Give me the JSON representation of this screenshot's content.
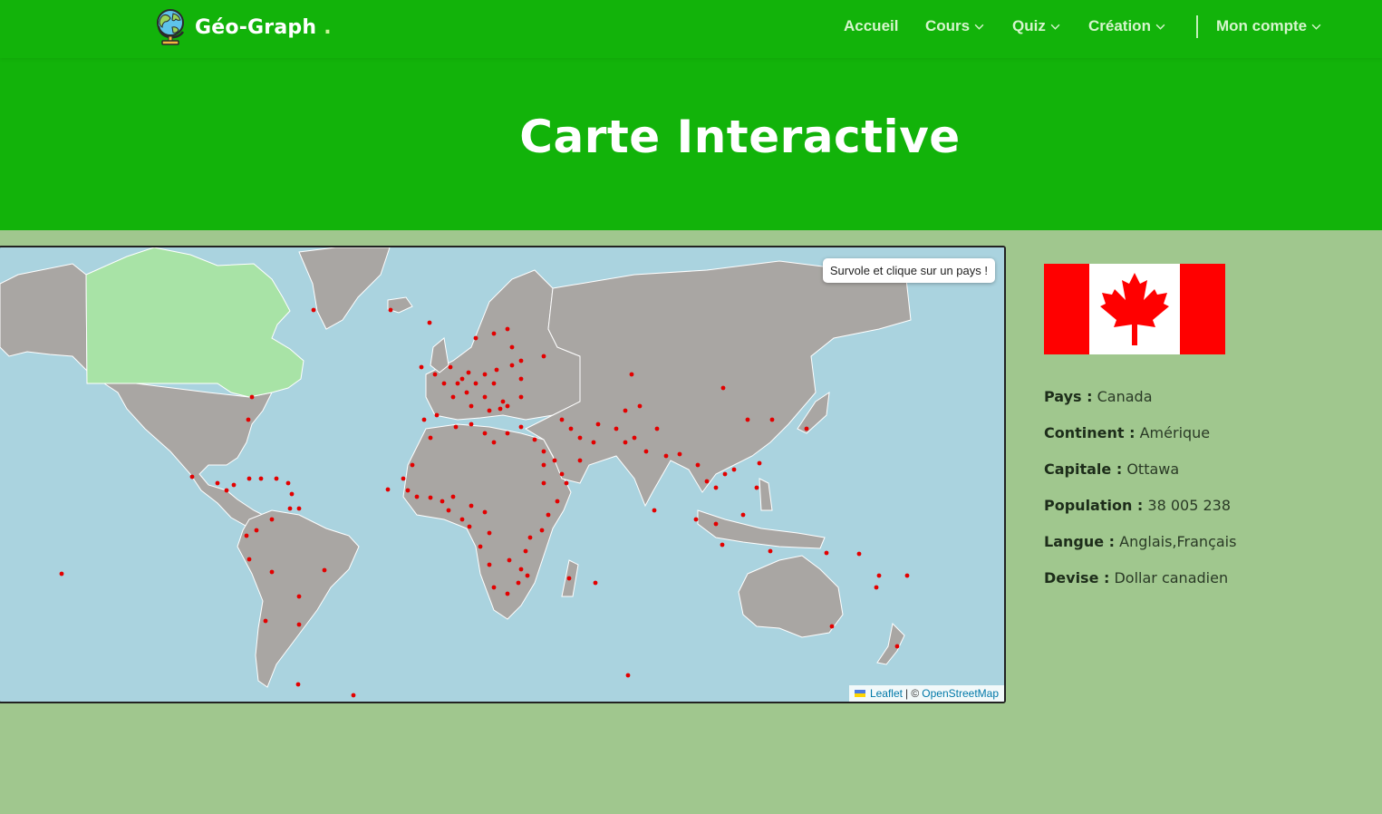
{
  "brand": {
    "name": "Géo-Graph",
    "dot": "."
  },
  "nav": {
    "items": [
      {
        "label": "Accueil",
        "dropdown": false
      },
      {
        "label": "Cours",
        "dropdown": true
      },
      {
        "label": "Quiz",
        "dropdown": true
      },
      {
        "label": "Création",
        "dropdown": true
      },
      {
        "label": "Mon compte",
        "dropdown": true
      }
    ]
  },
  "hero": {
    "title": "Carte Interactive"
  },
  "map": {
    "tooltip": "Survole et clique sur un pays !",
    "highlighted_country": "Canada",
    "attribution": {
      "leaflet": "Leaflet",
      "sep": "| ©",
      "osm": "OpenStreetMap"
    }
  },
  "country": {
    "flag": "canada-flag",
    "fields": [
      {
        "key": "Pays :",
        "value": "Canada"
      },
      {
        "key": "Continent :",
        "value": "Amérique"
      },
      {
        "key": "Capitale :",
        "value": "Ottawa"
      },
      {
        "key": "Population :",
        "value": "38 005 238"
      },
      {
        "key": "Langue :",
        "value": "Anglais,Français"
      },
      {
        "key": "Devise :",
        "value": "Dollar canadien"
      }
    ]
  },
  "colors": {
    "primary_green": "#12b30a",
    "page_bg": "#a0c78e",
    "ocean": "#aad3df",
    "land": "#a9a6a3",
    "highlight": "#a8e3a6",
    "marker": "#e30000"
  }
}
